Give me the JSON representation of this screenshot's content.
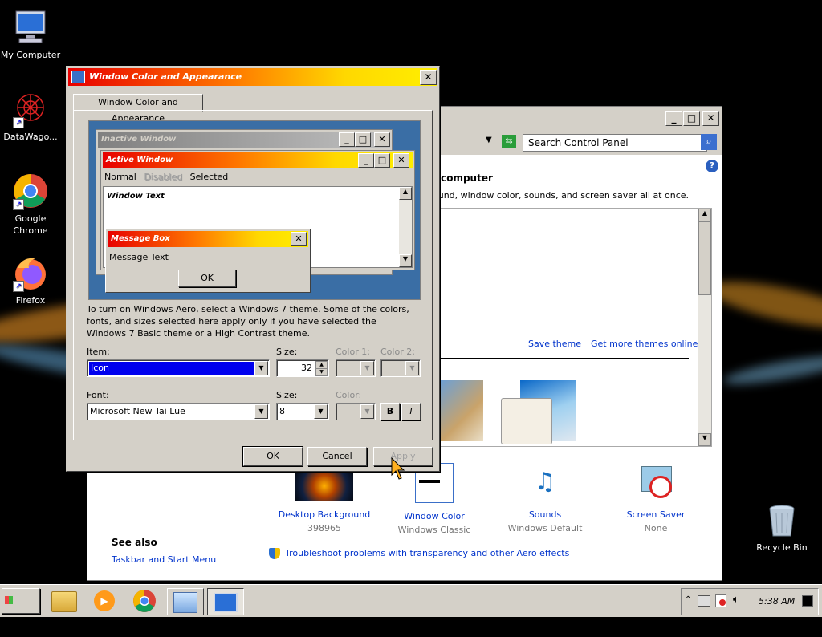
{
  "desktop": {
    "icons": [
      {
        "label": "My Computer"
      },
      {
        "label": "DataWago..."
      },
      {
        "label": "Google Chrome"
      },
      {
        "label": "Firefox"
      },
      {
        "label": "Recycle Bin"
      }
    ]
  },
  "control_panel": {
    "search_placeholder": "Search Control Panel",
    "heading": "r computer",
    "description": "ound, window color, sounds, and screen saver all at once.",
    "save_theme": "Save theme",
    "more_themes": "Get more themes online",
    "items": [
      {
        "label": "Desktop Background",
        "sub": "398965"
      },
      {
        "label": "Window Color",
        "sub": "Windows Classic"
      },
      {
        "label": "Sounds",
        "sub": "Windows Default"
      },
      {
        "label": "Screen Saver",
        "sub": "None"
      }
    ],
    "see_also": "See also",
    "taskbar_link": "Taskbar and Start Menu",
    "troubleshoot": "Troubleshoot problems with transparency and other Aero effects"
  },
  "dialog": {
    "title": "Window Color and Appearance",
    "tab": "Window Color and Appearance",
    "preview": {
      "inactive_title": "Inactive Window",
      "active_title": "Active Window",
      "menu_normal": "Normal",
      "menu_disabled": "Disabled",
      "menu_selected": "Selected",
      "window_text": "Window Text",
      "msgbox_title": "Message Box",
      "msgbox_text": "Message Text",
      "ok": "OK"
    },
    "info": "To turn on Windows Aero, select a Windows 7 theme.  Some of the colors, fonts, and sizes selected here apply only if you have selected the Windows 7 Basic theme or a High Contrast theme.",
    "item_label": "Item:",
    "item_value": "Icon",
    "size_label": "Size:",
    "size_value": "32",
    "color1_label": "Color 1:",
    "color2_label": "Color 2:",
    "font_label": "Font:",
    "font_value": "Microsoft New Tai Lue",
    "font_size_label": "Size:",
    "font_size_value": "8",
    "font_color_label": "Color:",
    "bold": "B",
    "italic": "I",
    "ok": "OK",
    "cancel": "Cancel",
    "apply": "Apply"
  },
  "taskbar": {
    "start": "Start",
    "clock": "5:38 AM"
  },
  "colors": {
    "selection": "#0000ee",
    "link": "#0033cc"
  }
}
